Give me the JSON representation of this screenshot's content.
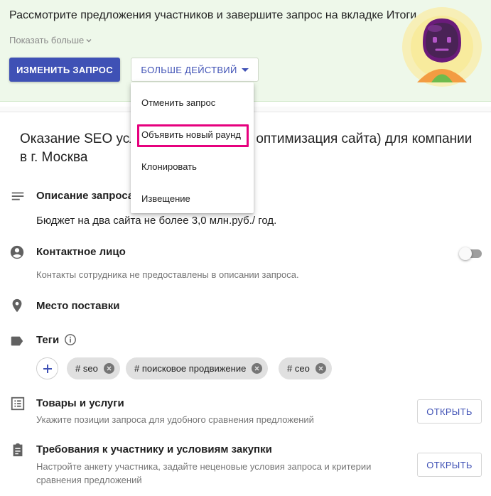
{
  "banner": {
    "message": "Рассмотрите предложения участников и завершите запрос на вкладке Итоги.",
    "show_more": "Показать больше",
    "edit_button": "ИЗМЕНИТЬ ЗАПРОС",
    "more_actions_button": "БОЛЬШЕ ДЕЙСТВИЙ"
  },
  "menu": {
    "items": [
      "Отменить запрос",
      "Объявить новый раунд",
      "Клонировать",
      "Извещение"
    ],
    "highlighted_index": 1
  },
  "request": {
    "title": "Оказание SEO услуг (продвижение и оптимизация сайта) для компании в г. Москва"
  },
  "sections": {
    "description": {
      "title": "Описание запроса",
      "body": "Бюджет на два сайта не более 3,0 млн.руб./ год."
    },
    "contact": {
      "title": "Контактное лицо",
      "subtitle": "Контакты сотрудника не предоставлены в описании запроса.",
      "toggle_on": false
    },
    "delivery": {
      "title": "Место поставки"
    },
    "tags": {
      "title": "Теги",
      "chips": [
        "# seo",
        "# поисковое продвижение",
        "# сео"
      ]
    },
    "goods": {
      "title": "Товары и услуги",
      "subtitle": "Укажите позиции запроса для удобного сравнения предложений",
      "button": "ОТКРЫТЬ"
    },
    "requirements": {
      "title": "Требования к участнику и условиям закупки",
      "subtitle": "Настройте анкету участника, задайте неценовые условия запроса и критерии сравнения предложений",
      "button": "ОТКРЫТЬ"
    }
  },
  "colors": {
    "primary": "#3f51b5",
    "banner_bg": "#eef8ea",
    "highlight": "#e6007e",
    "chip_bg": "#e0e0e0"
  }
}
